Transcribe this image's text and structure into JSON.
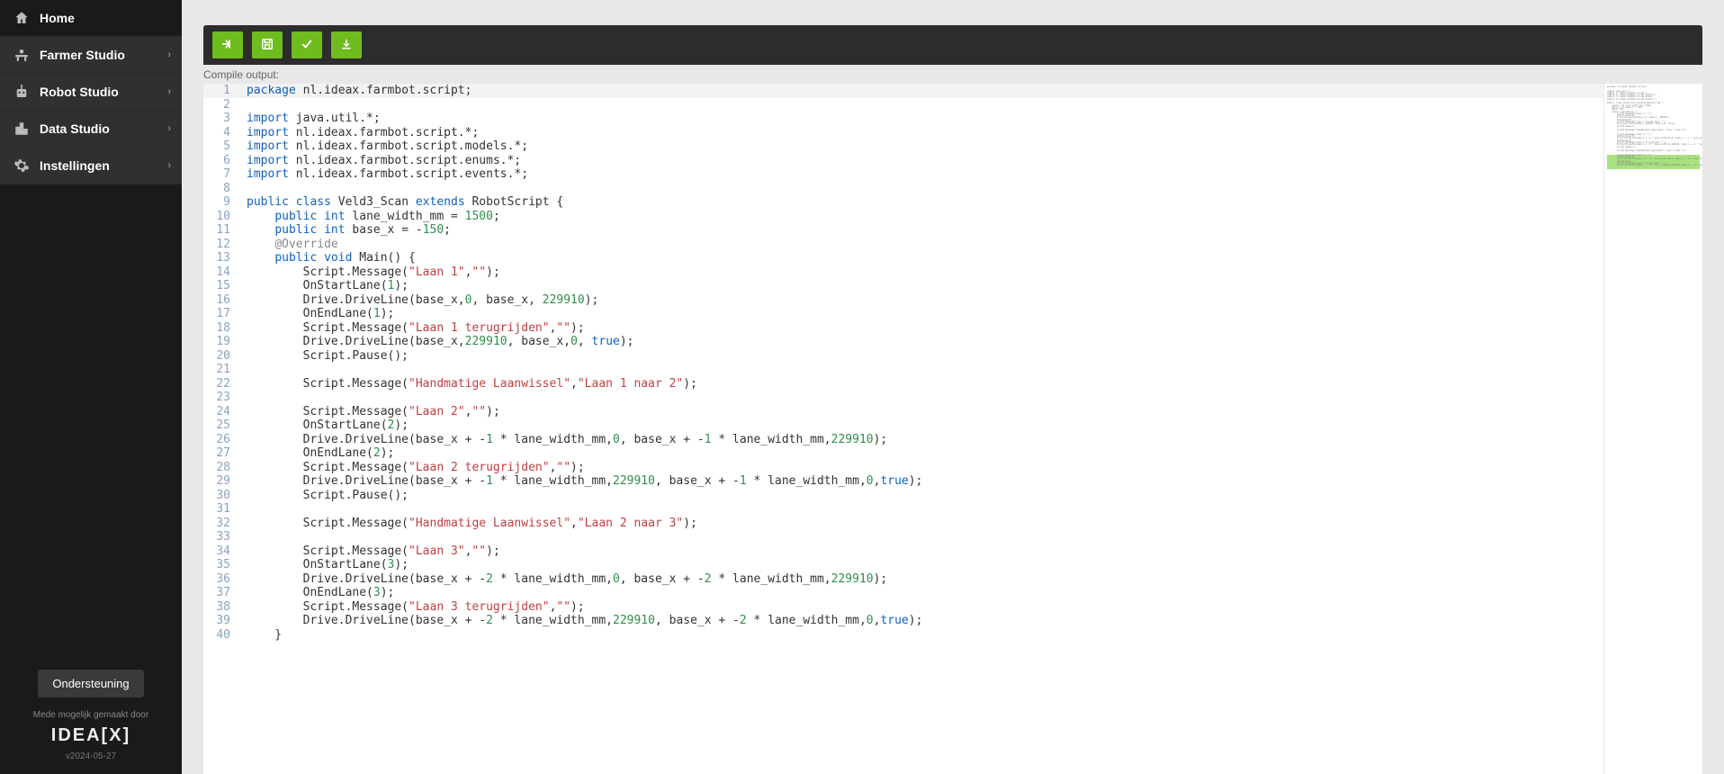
{
  "sidebar": {
    "items": [
      {
        "label": "Home",
        "icon": "home",
        "expandable": false
      },
      {
        "label": "Farmer Studio",
        "icon": "farmer",
        "expandable": true
      },
      {
        "label": "Robot Studio",
        "icon": "robot",
        "expandable": true
      },
      {
        "label": "Data Studio",
        "icon": "data",
        "expandable": true
      },
      {
        "label": "Instellingen",
        "icon": "gear",
        "expandable": true
      }
    ],
    "support_label": "Ondersteuning",
    "made_by": "Mede mogelijk gemaakt door",
    "logo": "IDEA[X]",
    "version": "v2024-05-27"
  },
  "toolbar": {
    "compile_output_label": "Compile output:"
  },
  "code_lines": [
    {
      "n": 1,
      "hl": true,
      "t": [
        [
          "kw",
          "package"
        ],
        [
          "",
          " nl.ideax.farmbot.script;"
        ]
      ]
    },
    {
      "n": 2,
      "t": [
        [
          "",
          ""
        ]
      ]
    },
    {
      "n": 3,
      "t": [
        [
          "kw",
          "import"
        ],
        [
          "",
          " java.util.*;"
        ]
      ]
    },
    {
      "n": 4,
      "t": [
        [
          "kw",
          "import"
        ],
        [
          "",
          " nl.ideax.farmbot.script.*;"
        ]
      ]
    },
    {
      "n": 5,
      "t": [
        [
          "kw",
          "import"
        ],
        [
          "",
          " nl.ideax.farmbot.script.models.*;"
        ]
      ]
    },
    {
      "n": 6,
      "t": [
        [
          "kw",
          "import"
        ],
        [
          "",
          " nl.ideax.farmbot.script.enums.*;"
        ]
      ]
    },
    {
      "n": 7,
      "t": [
        [
          "kw",
          "import"
        ],
        [
          "",
          " nl.ideax.farmbot.script.events.*;"
        ]
      ]
    },
    {
      "n": 8,
      "t": [
        [
          "",
          ""
        ]
      ]
    },
    {
      "n": 9,
      "t": [
        [
          "kw",
          "public"
        ],
        [
          "",
          " "
        ],
        [
          "kw",
          "class"
        ],
        [
          "",
          " Veld3_Scan "
        ],
        [
          "kw",
          "extends"
        ],
        [
          "",
          " RobotScript {"
        ]
      ]
    },
    {
      "n": 10,
      "t": [
        [
          "",
          "    "
        ],
        [
          "kw",
          "public"
        ],
        [
          "",
          " "
        ],
        [
          "kw",
          "int"
        ],
        [
          "",
          " lane_width_mm = "
        ],
        [
          "num",
          "1500"
        ],
        [
          "",
          ";"
        ]
      ]
    },
    {
      "n": 11,
      "t": [
        [
          "",
          "    "
        ],
        [
          "kw",
          "public"
        ],
        [
          "",
          " "
        ],
        [
          "kw",
          "int"
        ],
        [
          "",
          " base_x = -"
        ],
        [
          "num",
          "150"
        ],
        [
          "",
          ";"
        ]
      ]
    },
    {
      "n": 12,
      "t": [
        [
          "",
          "    "
        ],
        [
          "ann",
          "@Override"
        ]
      ]
    },
    {
      "n": 13,
      "t": [
        [
          "",
          "    "
        ],
        [
          "kw",
          "public"
        ],
        [
          "",
          " "
        ],
        [
          "kw",
          "void"
        ],
        [
          "",
          " Main() {"
        ]
      ]
    },
    {
      "n": 14,
      "t": [
        [
          "",
          "        Script.Message("
        ],
        [
          "str",
          "\"Laan 1\""
        ],
        [
          "",
          ","
        ],
        [
          "str",
          "\"\""
        ],
        [
          "",
          ");"
        ]
      ]
    },
    {
      "n": 15,
      "t": [
        [
          "",
          "        OnStartLane("
        ],
        [
          "num",
          "1"
        ],
        [
          "",
          ");"
        ]
      ]
    },
    {
      "n": 16,
      "t": [
        [
          "",
          "        Drive.DriveLine(base_x,"
        ],
        [
          "num",
          "0"
        ],
        [
          "",
          ", base_x, "
        ],
        [
          "num",
          "229910"
        ],
        [
          "",
          ");"
        ]
      ]
    },
    {
      "n": 17,
      "t": [
        [
          "",
          "        OnEndLane("
        ],
        [
          "num",
          "1"
        ],
        [
          "",
          ");"
        ]
      ]
    },
    {
      "n": 18,
      "t": [
        [
          "",
          "        Script.Message("
        ],
        [
          "str",
          "\"Laan 1 terugrijden\""
        ],
        [
          "",
          ","
        ],
        [
          "str",
          "\"\""
        ],
        [
          "",
          ");"
        ]
      ]
    },
    {
      "n": 19,
      "t": [
        [
          "",
          "        Drive.DriveLine(base_x,"
        ],
        [
          "num",
          "229910"
        ],
        [
          "",
          ", base_x,"
        ],
        [
          "num",
          "0"
        ],
        [
          "",
          ", "
        ],
        [
          "kw",
          "true"
        ],
        [
          "",
          ");"
        ]
      ]
    },
    {
      "n": 20,
      "t": [
        [
          "",
          "        Script.Pause();"
        ]
      ]
    },
    {
      "n": 21,
      "t": [
        [
          "",
          ""
        ]
      ]
    },
    {
      "n": 22,
      "t": [
        [
          "",
          "        Script.Message("
        ],
        [
          "str",
          "\"Handmatige Laanwissel\""
        ],
        [
          "",
          ","
        ],
        [
          "str",
          "\"Laan 1 naar 2\""
        ],
        [
          "",
          ");"
        ]
      ]
    },
    {
      "n": 23,
      "t": [
        [
          "",
          ""
        ]
      ]
    },
    {
      "n": 24,
      "t": [
        [
          "",
          "        Script.Message("
        ],
        [
          "str",
          "\"Laan 2\""
        ],
        [
          "",
          ","
        ],
        [
          "str",
          "\"\""
        ],
        [
          "",
          ");"
        ]
      ]
    },
    {
      "n": 25,
      "t": [
        [
          "",
          "        OnStartLane("
        ],
        [
          "num",
          "2"
        ],
        [
          "",
          ");"
        ]
      ]
    },
    {
      "n": 26,
      "t": [
        [
          "",
          "        Drive.DriveLine(base_x + -"
        ],
        [
          "num",
          "1"
        ],
        [
          "",
          " * lane_width_mm,"
        ],
        [
          "num",
          "0"
        ],
        [
          "",
          ", base_x + -"
        ],
        [
          "num",
          "1"
        ],
        [
          "",
          " * lane_width_mm,"
        ],
        [
          "num",
          "229910"
        ],
        [
          "",
          ");"
        ]
      ]
    },
    {
      "n": 27,
      "t": [
        [
          "",
          "        OnEndLane("
        ],
        [
          "num",
          "2"
        ],
        [
          "",
          ");"
        ]
      ]
    },
    {
      "n": 28,
      "t": [
        [
          "",
          "        Script.Message("
        ],
        [
          "str",
          "\"Laan 2 terugrijden\""
        ],
        [
          "",
          ","
        ],
        [
          "str",
          "\"\""
        ],
        [
          "",
          ");"
        ]
      ]
    },
    {
      "n": 29,
      "t": [
        [
          "",
          "        Drive.DriveLine(base_x + -"
        ],
        [
          "num",
          "1"
        ],
        [
          "",
          " * lane_width_mm,"
        ],
        [
          "num",
          "229910"
        ],
        [
          "",
          ", base_x + -"
        ],
        [
          "num",
          "1"
        ],
        [
          "",
          " * lane_width_mm,"
        ],
        [
          "num",
          "0"
        ],
        [
          "",
          ","
        ],
        [
          "kw",
          "true"
        ],
        [
          "",
          ");"
        ]
      ]
    },
    {
      "n": 30,
      "t": [
        [
          "",
          "        Script.Pause();"
        ]
      ]
    },
    {
      "n": 31,
      "t": [
        [
          "",
          ""
        ]
      ]
    },
    {
      "n": 32,
      "t": [
        [
          "",
          "        Script.Message("
        ],
        [
          "str",
          "\"Handmatige Laanwissel\""
        ],
        [
          "",
          ","
        ],
        [
          "str",
          "\"Laan 2 naar 3\""
        ],
        [
          "",
          ");"
        ]
      ]
    },
    {
      "n": 33,
      "t": [
        [
          "",
          ""
        ]
      ]
    },
    {
      "n": 34,
      "t": [
        [
          "",
          "        Script.Message("
        ],
        [
          "str",
          "\"Laan 3\""
        ],
        [
          "",
          ","
        ],
        [
          "str",
          "\"\""
        ],
        [
          "",
          ");"
        ]
      ]
    },
    {
      "n": 35,
      "t": [
        [
          "",
          "        OnStartLane("
        ],
        [
          "num",
          "3"
        ],
        [
          "",
          ");"
        ]
      ]
    },
    {
      "n": 36,
      "t": [
        [
          "",
          "        Drive.DriveLine(base_x + -"
        ],
        [
          "num",
          "2"
        ],
        [
          "",
          " * lane_width_mm,"
        ],
        [
          "num",
          "0"
        ],
        [
          "",
          ", base_x + -"
        ],
        [
          "num",
          "2"
        ],
        [
          "",
          " * lane_width_mm,"
        ],
        [
          "num",
          "229910"
        ],
        [
          "",
          ");"
        ]
      ]
    },
    {
      "n": 37,
      "t": [
        [
          "",
          "        OnEndLane("
        ],
        [
          "num",
          "3"
        ],
        [
          "",
          ");"
        ]
      ]
    },
    {
      "n": 38,
      "t": [
        [
          "",
          "        Script.Message("
        ],
        [
          "str",
          "\"Laan 3 terugrijden\""
        ],
        [
          "",
          ","
        ],
        [
          "str",
          "\"\""
        ],
        [
          "",
          ");"
        ]
      ]
    },
    {
      "n": 39,
      "t": [
        [
          "",
          "        Drive.DriveLine(base_x + -"
        ],
        [
          "num",
          "2"
        ],
        [
          "",
          " * lane_width_mm,"
        ],
        [
          "num",
          "229910"
        ],
        [
          "",
          ", base_x + -"
        ],
        [
          "num",
          "2"
        ],
        [
          "",
          " * lane_width_mm,"
        ],
        [
          "num",
          "0"
        ],
        [
          "",
          ","
        ],
        [
          "kw",
          "true"
        ],
        [
          "",
          ");"
        ]
      ]
    },
    {
      "n": 40,
      "t": [
        [
          "",
          "    }"
        ]
      ]
    }
  ],
  "icons": {
    "home": "home-icon",
    "farmer": "farmer-icon",
    "robot": "robot-icon",
    "data": "data-icon",
    "gear": "gear-icon"
  }
}
